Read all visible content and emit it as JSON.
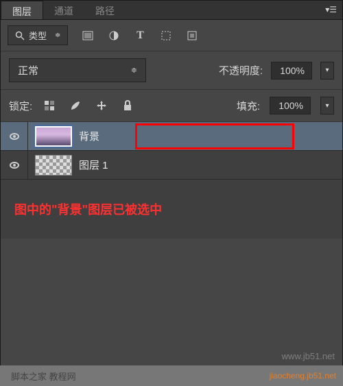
{
  "tabs": {
    "layers": "图层",
    "channels": "通道",
    "paths": "路径"
  },
  "filter": {
    "label": "类型",
    "search_icon": "search"
  },
  "blend": {
    "mode": "正常",
    "opacity_label": "不透明度:",
    "opacity_value": "100%"
  },
  "lock": {
    "label": "锁定:",
    "fill_label": "填充:",
    "fill_value": "100%"
  },
  "layers_list": [
    {
      "name": "背景",
      "selected": true,
      "thumb": "bg"
    },
    {
      "name": "图层 1",
      "selected": false,
      "thumb": "trans"
    }
  ],
  "annotation_text": "图中的\"背景\"图层已被选中",
  "watermark1": "www.jb51.net",
  "watermark2": "脚本之家 教程网",
  "watermark3": "jiaocheng.jb51.net"
}
